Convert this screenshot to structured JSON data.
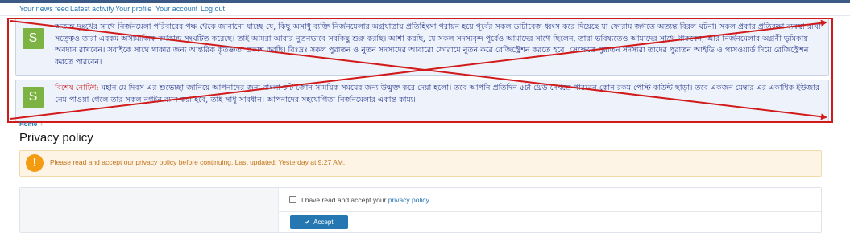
{
  "nav": {
    "items": [
      "Your news feed",
      "Latest activity",
      "Your profile",
      "Your account",
      "Log out"
    ]
  },
  "notices": [
    {
      "avatar_letter": "S",
      "lead": "",
      "text": "অত্যন্ত দুঃখের সাথে নির্জনমেলা পরিবারের পক্ষ থেকে জানানো যাচ্ছে যে, কিছু অসাধু ব্যক্তি নির্জনমেলার অগ্রযাত্রায় প্রতিহিংসা পরায়ন হয়ে পূর্বের সকল ডাটাবেজ ধ্বংস করে দিয়েছে যা ফোরাম জগতে অত্যন্ত বিরল ঘটনা। সকল প্রকার প্রতিরক্ষা ব্যবস্থা রাখা সত্ত্বেও তারা এরকম অসামাজিক কর্মকান্ড সংঘটিত করেছে। তাই আমরা আবার নুতনভাবে সবকিছু শুরু করছি। আশা করছি, যে সকল সদস্যবৃন্দ পূর্বেও আমাদের সাথে ছিলেন, তারা ভবিষ্যতেও আমাদের সাথে থাকবেন, আর নির্জনমেলার অগ্রনী ভূমিকায় অবদান রাখবেন। সবাইকে সাথে থাকার জন্য আন্তরিক কৃতজ্ঞতা প্রকাশ করছি। বিঃদ্রঃ সকল পুরাতন ও নুতন সদস্যদের আবারো ফোরামে নুতন করে রেজিস্ট্রেশন করতে হবে। সেক্ষেত্রে পুরাতন সদস্যরা তাদের পুরাতন আইডি ও পাসওয়ার্ড দিয়ে রেজিস্ট্রেশন করতে পারবেন।"
    },
    {
      "avatar_letter": "S",
      "lead": "বিশেষ নোটিশ:",
      "text": " মহান মে দিবস এর শুভেচ্ছা জানিয়ে আপনাদের জন্য বাংলা চটি জোন সাময়িক সময়ের জন্য উন্মুক্ত করে দেয়া হলো। তবে আপনি প্রতিদিন ৫টা থ্রেড দেখতে পারবেন কোন রকম পোস্ট কাউন্ট ছাড়া। তবে একজন মেম্বার এর একাধিক ইউজার নেম পাওয়া গেলে তার সকল নগইন ব্যান করা হবে, তাই সাধু সাবধান। আপনাদের সহযোগিতা নির্জনমেলার একান্ত কাম্য।"
    }
  ],
  "annotation": {
    "color": "#d11a1a"
  },
  "breadcrumb": {
    "home": "Home",
    "separator": "›"
  },
  "page": {
    "title": "Privacy policy"
  },
  "alert": {
    "icon": "warning-icon",
    "message": "Please read and accept our privacy policy before continuing. Last updated: Yesterday at 9:27 AM."
  },
  "form": {
    "checkbox_label": "I have read and accept your ",
    "policy_link": "privacy policy",
    "checkbox_suffix": ".",
    "accept_label": "Accept"
  },
  "colors": {
    "accent": "#2577b1",
    "header": "#3b5a86",
    "avatar": "#7cb342",
    "warning": "#f39c12"
  }
}
